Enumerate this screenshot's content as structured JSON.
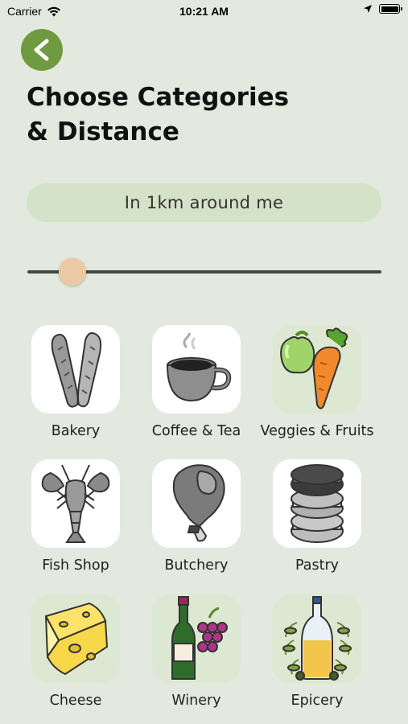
{
  "status_bar": {
    "carrier": "Carrier",
    "time": "10:21 AM"
  },
  "header": {
    "title_line1": "Choose Categories",
    "title_line2": "& Distance"
  },
  "distance": {
    "label": "In 1km around me",
    "slider_value_fraction": 0.13
  },
  "categories": [
    {
      "label": "Bakery",
      "icon": "bread-icon",
      "selected": false
    },
    {
      "label": "Coffee & Tea",
      "icon": "coffee-cup-icon",
      "selected": false
    },
    {
      "label": "Veggies & Fruits",
      "icon": "apple-carrot-icon",
      "selected": true
    },
    {
      "label": "Fish Shop",
      "icon": "lobster-icon",
      "selected": false
    },
    {
      "label": "Butchery",
      "icon": "ham-icon",
      "selected": false
    },
    {
      "label": "Pastry",
      "icon": "macarons-icon",
      "selected": false
    },
    {
      "label": "Cheese",
      "icon": "cheese-icon",
      "selected": true
    },
    {
      "label": "Winery",
      "icon": "wine-grapes-icon",
      "selected": true
    },
    {
      "label": "Epicery",
      "icon": "olive-oil-icon",
      "selected": true
    }
  ],
  "colors": {
    "background": "#e3e9df",
    "accent": "#6f9a3f",
    "pill": "#d4e2c8",
    "thumb": "#ecc9a5"
  }
}
